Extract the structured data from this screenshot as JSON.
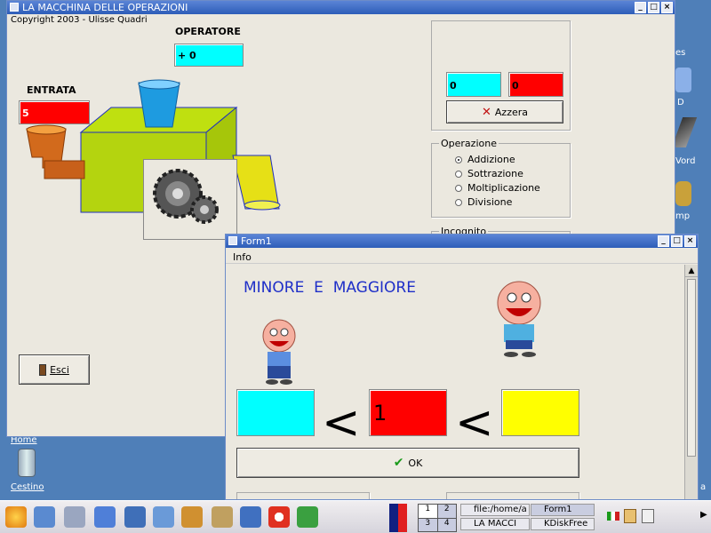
{
  "desktop": {
    "icons": [
      {
        "label": "Home"
      },
      {
        "label": "Cestino"
      }
    ],
    "right_partial_labels": [
      "es",
      "D",
      "Vord",
      "mp",
      "a"
    ]
  },
  "main_window": {
    "title": "LA MACCHINA DELLE OPERAZIONI",
    "copyright": "Copyright 2003 - Ulisse Quadri",
    "operatore_label": "OPERATORE",
    "operatore_value": "+ 0",
    "entrata_label": "ENTRATA",
    "entrata_value": "5",
    "result_left": "0",
    "result_right": "0",
    "azzera_label": "Azzera",
    "operazione_group": "Operazione",
    "operations": [
      {
        "label": "Addizione",
        "selected": true
      },
      {
        "label": "Sottrazione",
        "selected": false
      },
      {
        "label": "Moltiplicazione",
        "selected": false
      },
      {
        "label": "Divisione",
        "selected": false
      }
    ],
    "incognito_group": "Incognito",
    "esci_label": "Esci"
  },
  "form1": {
    "title": "Form1",
    "menu_info": "Info",
    "heading": "MINORE  E  MAGGIORE",
    "box_left": "",
    "box_middle": "1",
    "box_right": "",
    "less_than_1": "<",
    "less_than_2": "<",
    "ok_label": "OK"
  },
  "taskbar": {
    "desktops": [
      "1",
      "2",
      "3",
      "4"
    ],
    "tasks": [
      {
        "label": "file:/home/a"
      },
      {
        "label": "Form1"
      },
      {
        "label": "LA MACCI"
      },
      {
        "label": "KDiskFree"
      }
    ]
  },
  "colors": {
    "cyan": "#00ffff",
    "red": "#ff0000",
    "yellow": "#ffff00",
    "heading_blue": "#1f2fc8",
    "window_bg": "#ebe8df"
  }
}
